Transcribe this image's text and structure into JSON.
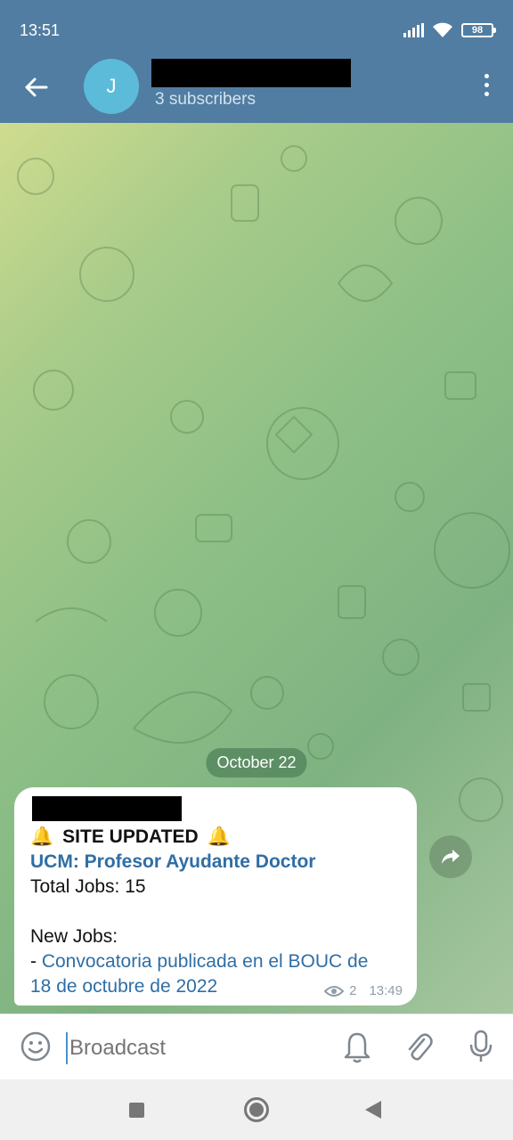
{
  "status_bar": {
    "time": "13:51",
    "battery": "98"
  },
  "header": {
    "avatar_letter": "J",
    "subtitle": "3 subscribers"
  },
  "chat": {
    "date_label": "October 22",
    "message": {
      "title": "SITE UPDATED",
      "title_emoji": "🔔",
      "link_title": "UCM: Profesor Ayudante Doctor",
      "total_jobs": "Total Jobs: 15",
      "new_jobs_label": "New Jobs:",
      "job_prefix": "- ",
      "job_link_line1": "Convocatoria publicada en el BOUC de",
      "job_link_line2": "18 de octubre de 2022",
      "views": "2",
      "time": "13:49"
    }
  },
  "input": {
    "placeholder": "Broadcast"
  },
  "colors": {
    "header": "#517da2",
    "link": "#2f6ea5",
    "bubble": "#ffffff"
  }
}
